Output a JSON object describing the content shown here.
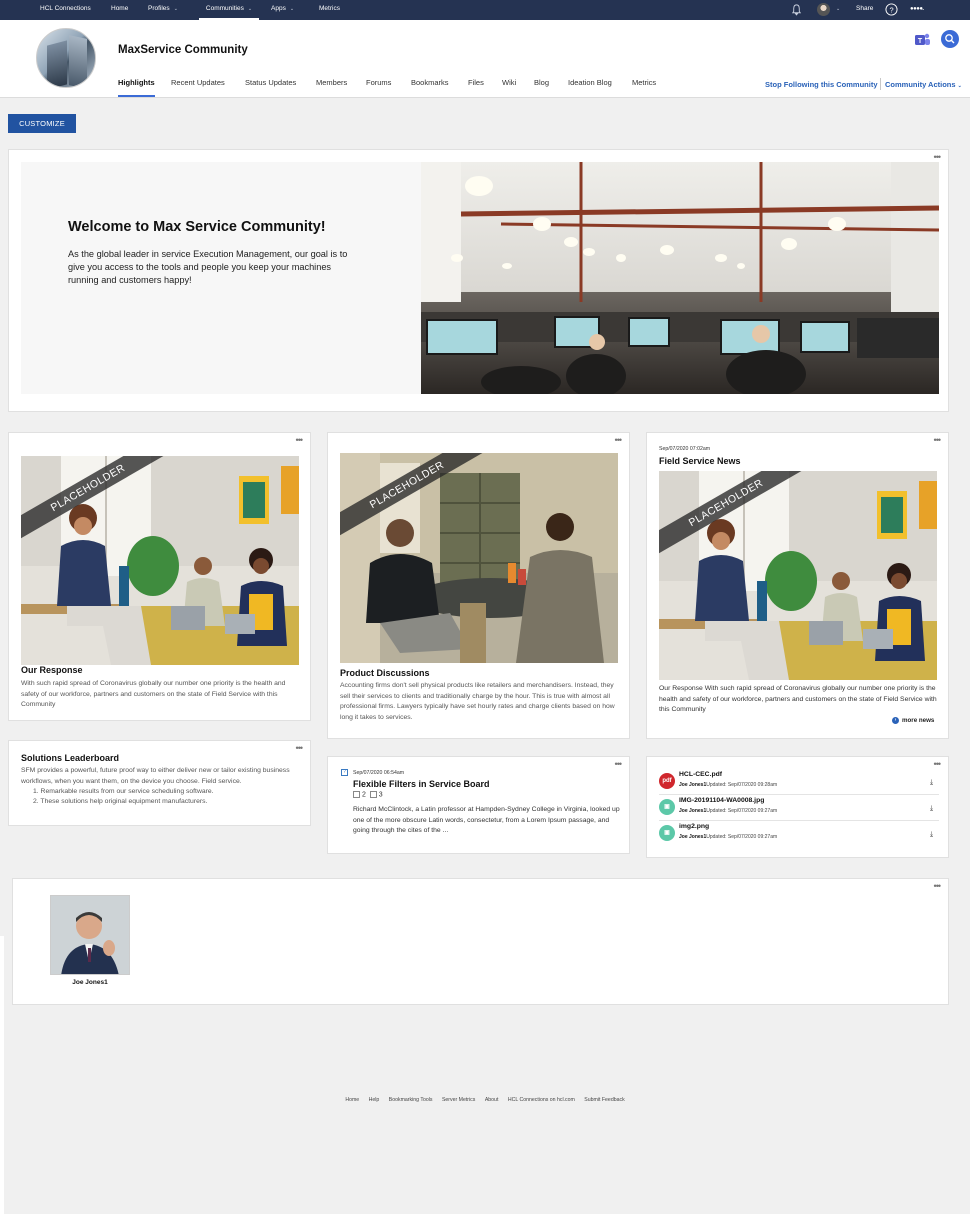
{
  "topnav": {
    "brand": "HCL Connections",
    "home": "Home",
    "profiles": "Profiles",
    "communities": "Communities",
    "apps": "Apps",
    "metrics": "Metrics",
    "share": "Share",
    "icons": [
      "bell-icon",
      "avatar",
      "help-icon",
      "logo-icon"
    ]
  },
  "header": {
    "title": "MaxService Community",
    "tabs": [
      "Highlights",
      "Recent Updates",
      "Status Updates",
      "Members",
      "Forums",
      "Bookmarks",
      "Files",
      "Wiki",
      "Blog",
      "Ideation Blog",
      "Metrics"
    ],
    "stop_following": "Stop Following this Community",
    "community_actions": "Community Actions"
  },
  "customize_label": "CUSTOMIZE",
  "welcome": {
    "title": "Welcome to Max Service Community!",
    "text": "As the global leader in service Execution Management, our goal is to give you access to the tools and people you keep your machines running and customers happy!"
  },
  "placeholder_label": "PLACEHOLDER",
  "cards": {
    "response": {
      "title": "Our Response",
      "text": "With such rapid spread of Coronavirus globally our number one priority is the health and safety of our workforce, partners and customers on the state of Field Service with this Community"
    },
    "product": {
      "title": "Product Discussions",
      "text": "Accounting firms don't sell physical products like retailers and merchandisers. Instead, they sell their services to clients and traditionally charge by the hour. This is true with almost all professional firms. Lawyers typically have set hourly rates and charge clients based on how long it takes to services."
    },
    "news": {
      "date": "Sep/07/2020 07:02am",
      "title": "Field Service News",
      "text": "Our Response With such rapid spread of Coronavirus globally our number one priority is the health and safety of our workforce, partners and customers on the state of Field Service with this Community",
      "more": "more news"
    },
    "leaderboard": {
      "title": "Solutions Leaderboard",
      "text": "SFM provides a powerful, future proof way to either deliver new or tailor existing business workflows, when you want them, on the device you choose. Field service.",
      "items": [
        "1.  Remarkable results from our service scheduling software.",
        "2.  These solutions help original equipment manufacturers."
      ]
    },
    "forum": {
      "date": "Sep/07/2020 06:54am",
      "title": "Flexible Filters in Service Board",
      "replies": "2",
      "views": "3",
      "text": "Richard McClintock, a Latin professor at Hampden-Sydney College in Virginia, looked up one of the more obscure Latin words, consectetur, from a Lorem Ipsum passage, and going through the cites of the ..."
    },
    "files": [
      {
        "name": "HCL-CEC.pdf",
        "user": "Joe Jones1",
        "updated": "Updated: Sep/07/2020 09:28am",
        "type": "pdf",
        "color": "#d0272d"
      },
      {
        "name": "IMG-20191104-WA0008.jpg",
        "user": "Joe Jones1",
        "updated": "Updated: Sep/07/2020 09:27am",
        "type": "img",
        "color": "#5cc8a8"
      },
      {
        "name": "img2.png",
        "user": "Joe Jones1",
        "updated": "Updated: Sep/07/2020 09:27am",
        "type": "img",
        "color": "#5cc8a8"
      }
    ]
  },
  "member": {
    "name": "Joe Jones1"
  },
  "footer": [
    "Home",
    "Help",
    "Bookmarking Tools",
    "Server Metrics",
    "About",
    "HCL Connections on hcl.com",
    "Submit Feedback"
  ],
  "colors": {
    "nav": "#253352",
    "accent": "#2153a1",
    "link": "#2a62b8"
  }
}
